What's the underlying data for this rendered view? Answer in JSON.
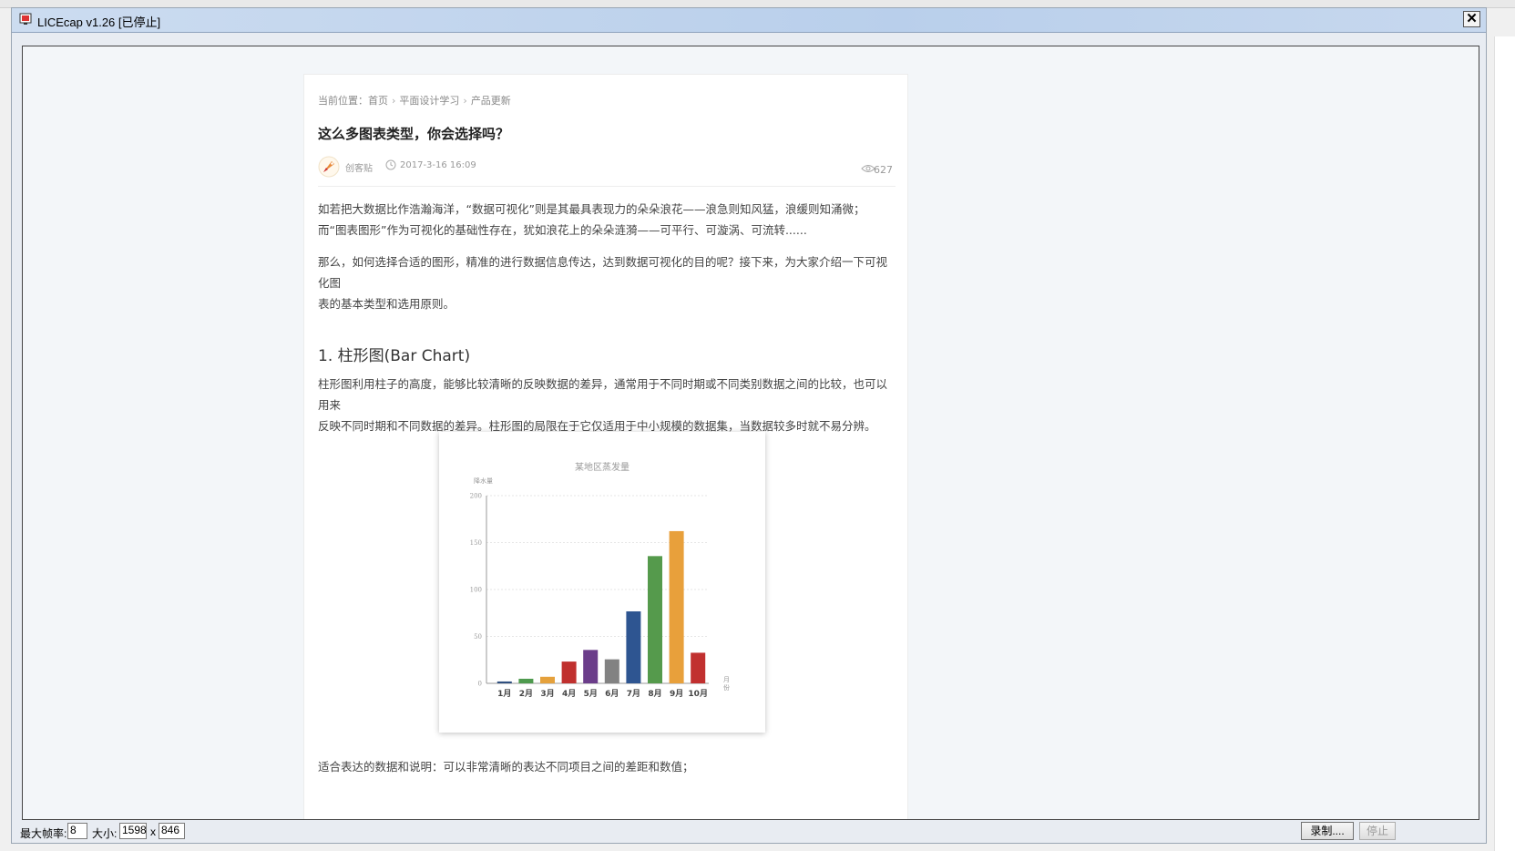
{
  "window": {
    "title": "LICEcap v1.26 [已停止]",
    "close_glyph": "✕"
  },
  "article": {
    "breadcrumb": {
      "prefix": "当前位置：",
      "items": [
        "首页",
        "平面设计学习",
        "产品更新"
      ],
      "separator": "›"
    },
    "title": "这么多图表类型，你会选择吗？",
    "author": "创客贴",
    "date": "2017-3-16 16:09",
    "views": "627",
    "intro_line1": "如若把大数据比作浩瀚海洋，“数据可视化”则是其最具表现力的朵朵浪花——浪急则知风猛，浪缓则知涌微；",
    "intro_line2": "而“图表图形”作为可视化的基础性存在，犹如浪花上的朵朵涟漪——可平行、可漩涡、可流转......",
    "para2_line1": "那么，如何选择合适的图形，精准的进行数据信息传达，达到数据可视化的目的呢？接下来，为大家介绍一下可视化图",
    "para2_line2": "表的基本类型和选用原则。",
    "section_title": "1. 柱形图(Bar Chart)",
    "section_para_line1": "柱形图利用柱子的高度，能够比较清晰的反映数据的差异，通常用于不同时期或不同类别数据之间的比较，也可以用来",
    "section_para_line2": "反映不同时期和不同数据的差异。柱形图的局限在于它仅适用于中小规模的数据集，当数据较多时就不易分辨。",
    "bottom_text": "适合表达的数据和说明：可以非常清晰的表达不同项目之间的差距和数值；"
  },
  "icons": {
    "avatar": "rocket-avatar-icon",
    "clock": "clock-icon",
    "eye": "eye-icon",
    "app": "licecap-app-icon"
  },
  "chart_data": {
    "type": "bar",
    "title": "某地区蒸发量",
    "ylabel": "降水量",
    "xlabel": "月份",
    "categories": [
      "1月",
      "2月",
      "3月",
      "4月",
      "5月",
      "6月",
      "7月",
      "8月",
      "9月",
      "10月"
    ],
    "values": [
      2.0,
      4.9,
      7.0,
      23.2,
      35.6,
      25.6,
      76.7,
      135.6,
      162.2,
      32.6
    ],
    "colors": [
      "#2f4f7f",
      "#4e9a4e",
      "#e5a13c",
      "#c0302e",
      "#6b3d8a",
      "#828282",
      "#2e5591",
      "#559a4c",
      "#e8a03b",
      "#c1302f"
    ],
    "ylim": [
      0,
      200
    ],
    "yticks": [
      0,
      50,
      100,
      150,
      200
    ],
    "grid": true
  },
  "bottombar": {
    "fps_label": "最大帧率:",
    "fps_value": "8",
    "size_label": "大小:",
    "width_value": "1598",
    "x_label": "x",
    "height_value": "846",
    "record_label": "录制....",
    "stop_label": "停止"
  }
}
